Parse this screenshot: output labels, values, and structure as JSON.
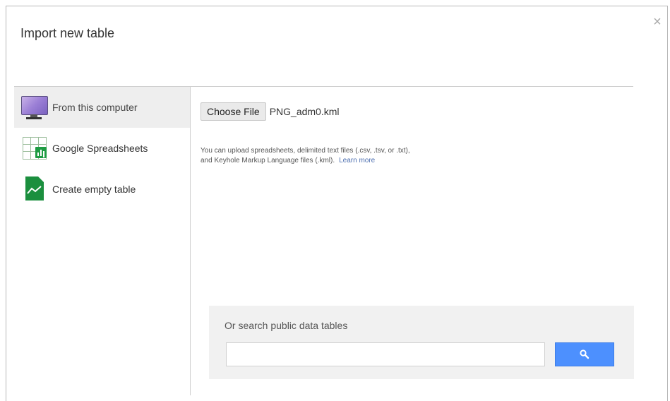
{
  "dialog": {
    "title": "Import new table",
    "close_glyph": "×"
  },
  "sidebar": {
    "items": [
      {
        "label": "From this computer",
        "icon": "monitor-icon",
        "active": true
      },
      {
        "label": "Google Spreadsheets",
        "icon": "spreadsheet-icon",
        "active": false
      },
      {
        "label": "Create empty table",
        "icon": "chart-doc-icon",
        "active": false
      }
    ]
  },
  "upload": {
    "choose_button": "Choose File",
    "file_name": "PNG_adm0.kml",
    "help_line1": "You can upload spreadsheets, delimited text files (.csv, .tsv, or .txt),",
    "help_line2": "and Keyhole Markup Language files (.kml).",
    "learn_more": "Learn more"
  },
  "search": {
    "label": "Or search public data tables",
    "input_value": "",
    "placeholder": "",
    "button_icon": "search-icon"
  },
  "colors": {
    "accent": "#4d90fe",
    "sidebar_active_bg": "#eeeeee",
    "link": "#4d6fb0"
  }
}
